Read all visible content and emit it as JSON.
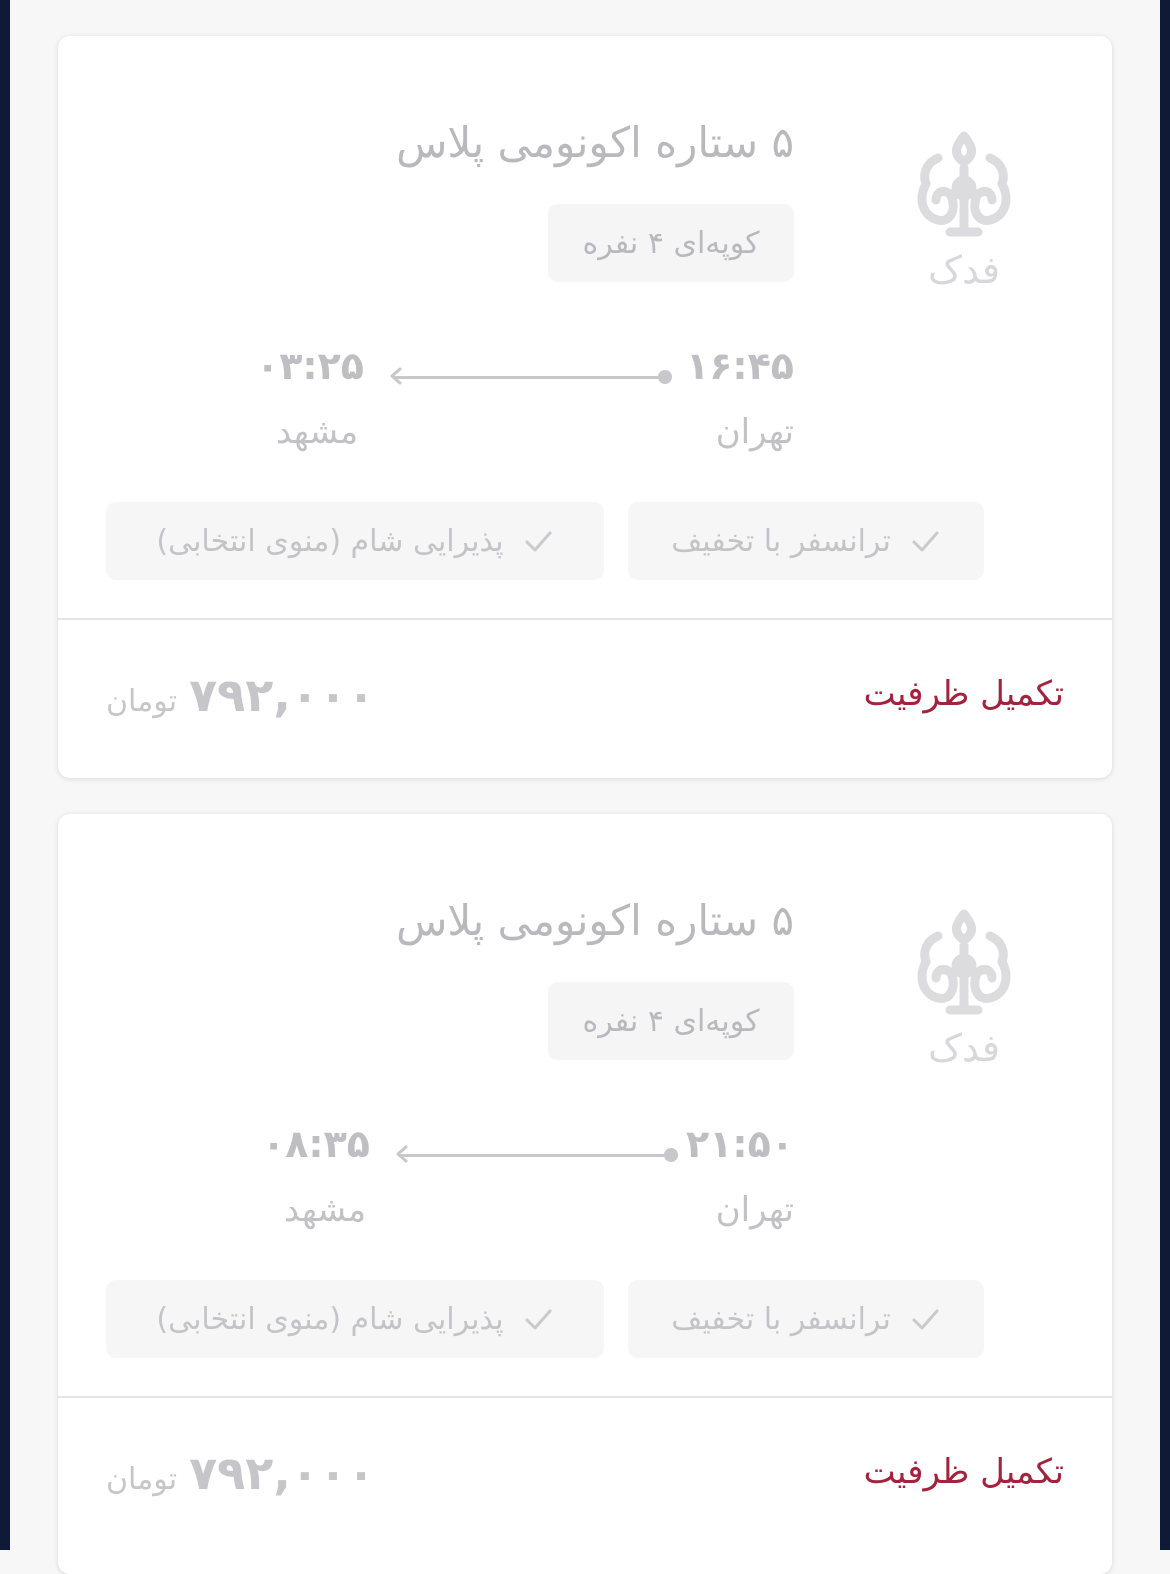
{
  "tickets": [
    {
      "company_name": "فدک",
      "title": "۵ ستاره اکونومی پلاس",
      "coupe": "کوپه‌ای ۴ نفره",
      "departure_time": "۱۶:۴۵",
      "arrival_time": "۰۳:۲۵",
      "origin": "تهران",
      "destination": "مشهد",
      "features": [
        "ترانسفر با تخفیف",
        "پذیرایی شام (منوی انتخابی)"
      ],
      "status": "تکمیل ظرفیت",
      "price": "۷۹۲,۰۰۰",
      "currency": "تومان"
    },
    {
      "company_name": "فدک",
      "title": "۵ ستاره اکونومی پلاس",
      "coupe": "کوپه‌ای ۴ نفره",
      "departure_time": "۲۱:۵۰",
      "arrival_time": "۰۸:۳۵",
      "origin": "تهران",
      "destination": "مشهد",
      "features": [
        "ترانسفر با تخفیف",
        "پذیرایی شام (منوی انتخابی)"
      ],
      "status": "تکمیل ظرفیت",
      "price": "۷۹۲,۰۰۰",
      "currency": "تومان"
    }
  ],
  "colors": {
    "status": "#a3233f",
    "muted_text": "#bfbfc3",
    "frame": "#0f1b36",
    "card": "#ffffff"
  },
  "icons": [
    "fadak-logo-icon",
    "arrow-left-icon",
    "check-icon"
  ]
}
